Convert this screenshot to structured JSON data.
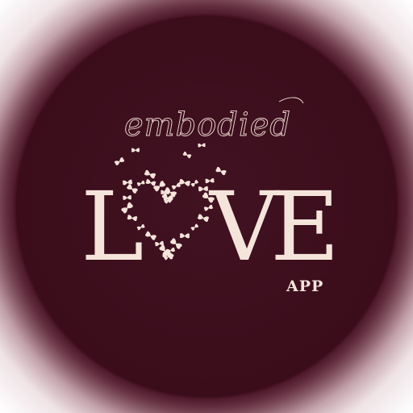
{
  "logo": {
    "script_word": "embodied",
    "letter_l": "L",
    "letter_v": "V",
    "letter_e": "E",
    "sub_label": "APP",
    "heart_symbol": "butterfly-heart-icon"
  },
  "colors": {
    "disc": "#3c0d1c",
    "glow": "#8a5a68",
    "text": "#f5e4da",
    "background": "#ffffff"
  }
}
